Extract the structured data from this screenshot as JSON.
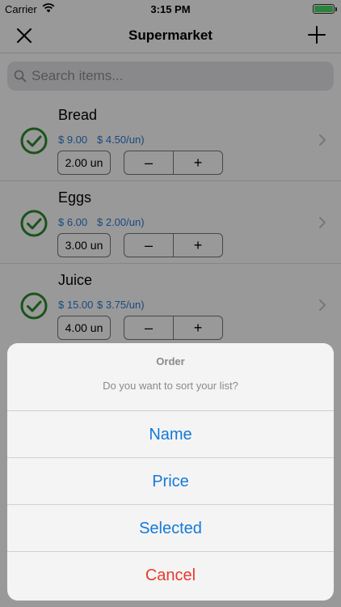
{
  "status_bar": {
    "carrier": "Carrier",
    "time": "3:15 PM"
  },
  "navbar": {
    "title": "Supermarket"
  },
  "search": {
    "placeholder": "Search items..."
  },
  "items": [
    {
      "name": "Bread",
      "price": "$ 9.00",
      "unit_price": "$ 4.50/un)",
      "quantity": "2.00 un"
    },
    {
      "name": "Eggs",
      "price": "$ 6.00",
      "unit_price": "$ 2.00/un)",
      "quantity": "3.00 un"
    },
    {
      "name": "Juice",
      "price": "$ 15.00",
      "unit_price": "$ 3.75/un)",
      "quantity": "4.00 un"
    }
  ],
  "stepper": {
    "minus": "–",
    "plus": "+"
  },
  "action_sheet": {
    "title": "Order",
    "message": "Do you want to sort your list?",
    "actions": [
      "Name",
      "Price",
      "Selected"
    ],
    "cancel": "Cancel"
  },
  "colors": {
    "accent": "#1479d8",
    "check": "#2e8b2e",
    "price": "#2a7bd5",
    "destructive": "#e8392f"
  }
}
